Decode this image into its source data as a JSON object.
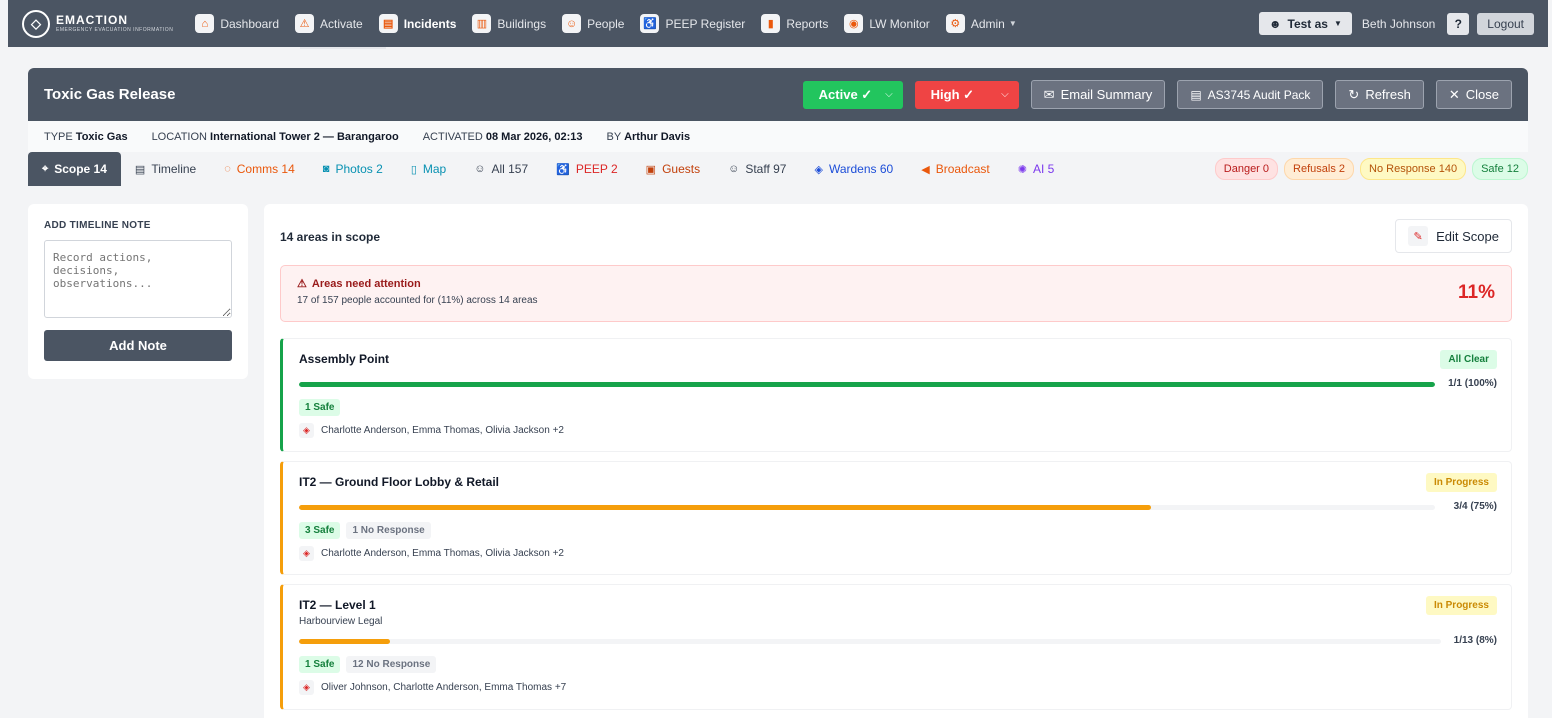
{
  "brand": {
    "name": "EMACTION",
    "tagline": "EMERGENCY EVACUATION INFORMATION"
  },
  "nav": [
    {
      "label": "Dashboard",
      "icon": "home-icon",
      "glyph": "⌂"
    },
    {
      "label": "Activate",
      "icon": "alarm-icon",
      "glyph": "⚠"
    },
    {
      "label": "Incidents",
      "icon": "clipboard-icon",
      "glyph": "▤",
      "active": true
    },
    {
      "label": "Buildings",
      "icon": "building-icon",
      "glyph": "▥"
    },
    {
      "label": "People",
      "icon": "person-icon",
      "glyph": "☺"
    },
    {
      "label": "PEEP Register",
      "icon": "wheelchair-icon",
      "glyph": "♿"
    },
    {
      "label": "Reports",
      "icon": "chart-icon",
      "glyph": "▮"
    },
    {
      "label": "LW Monitor",
      "icon": "broadcast-icon",
      "glyph": "◉"
    },
    {
      "label": "Admin",
      "icon": "gear-icon",
      "glyph": "⚙",
      "dropdown": true
    }
  ],
  "user": {
    "test_as": "Test as",
    "name": "Beth Johnson",
    "help": "?",
    "logout": "Logout"
  },
  "incident": {
    "title": "Toxic Gas Release",
    "status": "Active ✓",
    "severity": "High ✓",
    "email_summary": "Email Summary",
    "audit_pack": "AS3745 Audit Pack",
    "refresh": "Refresh",
    "close": "Close"
  },
  "meta": {
    "type_label": "TYPE",
    "type": "Toxic Gas",
    "location_label": "LOCATION",
    "location": "International Tower 2 — Barangaroo",
    "activated_label": "ACTIVATED",
    "activated": "08 Mar 2026, 02:13",
    "by_label": "BY",
    "by": "Arthur Davis"
  },
  "tabs": [
    {
      "label": "Scope 14",
      "glyph": "⌖",
      "icon": "location-pin-icon",
      "color": "#ffffff",
      "active": true
    },
    {
      "label": "Timeline",
      "glyph": "▤",
      "icon": "document-icon",
      "color": "#374151"
    },
    {
      "label": "Comms 14",
      "glyph": "◌",
      "icon": "chat-icon",
      "color": "#ea580c"
    },
    {
      "label": "Photos 2",
      "glyph": "◙",
      "icon": "camera-icon",
      "color": "#0891b2"
    },
    {
      "label": "Map",
      "glyph": "▯",
      "icon": "map-icon",
      "color": "#0891b2"
    },
    {
      "label": "All 157",
      "glyph": "☺",
      "icon": "people-icon",
      "color": "#374151"
    },
    {
      "label": "PEEP 2",
      "glyph": "♿",
      "icon": "wheelchair-icon",
      "color": "#dc2626"
    },
    {
      "label": "Guests",
      "glyph": "▣",
      "icon": "id-card-icon",
      "color": "#c2410c"
    },
    {
      "label": "Staff 97",
      "glyph": "☺",
      "icon": "person-icon",
      "color": "#374151"
    },
    {
      "label": "Wardens 60",
      "glyph": "◈",
      "icon": "shield-icon",
      "color": "#1d4ed8"
    },
    {
      "label": "Broadcast",
      "glyph": "◀",
      "icon": "megaphone-icon",
      "color": "#ea580c"
    },
    {
      "label": "AI 5",
      "glyph": "✺",
      "icon": "ai-brain-icon",
      "color": "#7c3aed"
    }
  ],
  "badges": [
    {
      "label": "Danger 0",
      "bg": "#fee2e2",
      "fg": "#b91c1c",
      "border": "#fecaca"
    },
    {
      "label": "Refusals 2",
      "bg": "#ffedd5",
      "fg": "#c2410c",
      "border": "#fed7aa"
    },
    {
      "label": "No Response 140",
      "bg": "#fef9c3",
      "fg": "#b45309",
      "border": "#fde68a"
    },
    {
      "label": "Safe 12",
      "bg": "#dcfce7",
      "fg": "#15803d",
      "border": "#bbf7d0"
    }
  ],
  "note_panel": {
    "title": "ADD TIMELINE NOTE",
    "placeholder": "Record actions, decisions, observations...",
    "button": "Add Note"
  },
  "scope": {
    "heading": "14 areas in scope",
    "edit_button": "Edit Scope",
    "alert_title": "Areas need attention",
    "alert_text": "17 of 157 people accounted for (11%) across 14 areas",
    "alert_pct": "11%"
  },
  "areas": [
    {
      "name": "Assembly Point",
      "subtitle": "",
      "status": "All Clear",
      "status_bg": "#dcfce7",
      "status_fg": "#15803d",
      "accent": "#16a34a",
      "progress": 1.0,
      "count": "1/1 (100%)",
      "chips": [
        {
          "label": "1 Safe",
          "kind": "safe"
        }
      ],
      "wardens": "Charlotte Anderson, Emma Thomas, Olivia Jackson +2"
    },
    {
      "name": "IT2 — Ground Floor Lobby & Retail",
      "subtitle": "",
      "status": "In Progress",
      "status_bg": "#fef9c3",
      "status_fg": "#ca8a04",
      "accent": "#f59e0b",
      "progress": 0.75,
      "count": "3/4 (75%)",
      "chips": [
        {
          "label": "3 Safe",
          "kind": "safe"
        },
        {
          "label": "1 No Response",
          "kind": "nores"
        }
      ],
      "wardens": "Charlotte Anderson, Emma Thomas, Olivia Jackson +2"
    },
    {
      "name": "IT2 — Level 1",
      "subtitle": "Harbourview Legal",
      "status": "In Progress",
      "status_bg": "#fef9c3",
      "status_fg": "#ca8a04",
      "accent": "#f59e0b",
      "progress": 0.08,
      "count": "1/13 (8%)",
      "chips": [
        {
          "label": "1 Safe",
          "kind": "safe"
        },
        {
          "label": "12 No Response",
          "kind": "nores"
        }
      ],
      "wardens": "Oliver Johnson, Charlotte Anderson, Emma Thomas +7"
    }
  ]
}
